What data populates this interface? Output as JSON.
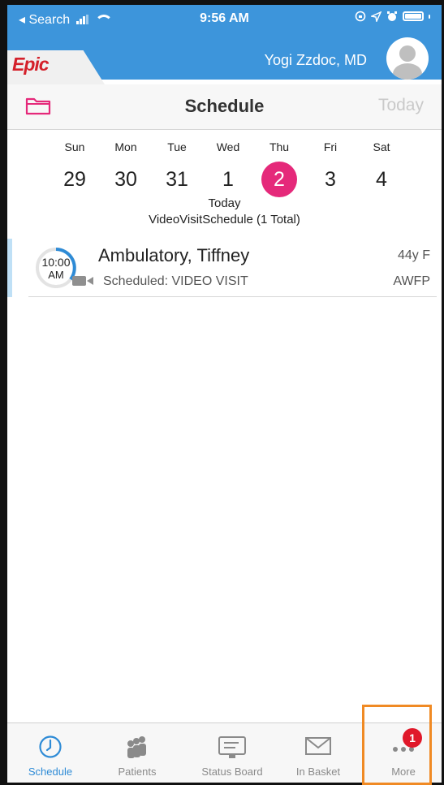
{
  "status_bar": {
    "back_label": "◂ Search",
    "time": "9:56 AM"
  },
  "header": {
    "logo_text": "Epic",
    "user_name": "Yogi Zzdoc, MD"
  },
  "titlebar": {
    "title": "Schedule",
    "today_button": "Today"
  },
  "week": {
    "days": [
      {
        "name": "Sun",
        "num": "29"
      },
      {
        "name": "Mon",
        "num": "30"
      },
      {
        "name": "Tue",
        "num": "31"
      },
      {
        "name": "Wed",
        "num": "1"
      },
      {
        "name": "Thu",
        "num": "2"
      },
      {
        "name": "Fri",
        "num": "3"
      },
      {
        "name": "Sat",
        "num": "4"
      }
    ],
    "selected_day_index": 4,
    "today_label": "Today",
    "schedule_label": "VideoVisitSchedule (1 Total)"
  },
  "appointments": [
    {
      "time": "10:00",
      "ampm": "AM",
      "patient_name": "Ambulatory, Tiffney",
      "status": "Scheduled: VIDEO VISIT",
      "age_sex": "44y F",
      "department": "AWFP",
      "icon": "video-camera-icon"
    }
  ],
  "tabbar": {
    "tabs": [
      {
        "label": "Schedule",
        "icon": "clock-icon",
        "active": true
      },
      {
        "label": "Patients",
        "icon": "patients-icon",
        "active": false
      },
      {
        "label": "Status Board",
        "icon": "status-board-icon",
        "active": false
      },
      {
        "label": "In Basket",
        "icon": "envelope-icon",
        "active": false
      },
      {
        "label": "More",
        "icon": "more-dots-icon",
        "active": false,
        "badge": "1"
      }
    ]
  },
  "colors": {
    "header_blue": "#3d95db",
    "selected_day": "#e5297a",
    "active_tab": "#2e8bd6",
    "badge": "#e0182a",
    "highlight_box": "#f08a24",
    "epic_red": "#d4202a"
  }
}
